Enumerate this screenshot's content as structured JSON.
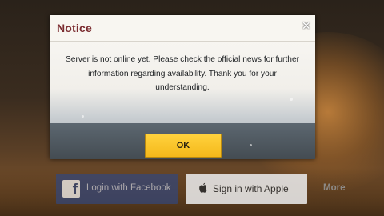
{
  "dialog": {
    "title": "Notice",
    "close_glyph": "×",
    "message": "Server is not online yet. Please check the official news for further information regarding availability. Thank you for your understanding.",
    "ok_label": "OK"
  },
  "login": {
    "facebook_label": "Login with Facebook",
    "facebook_icon": "facebook-icon",
    "apple_label": "Sign in with Apple",
    "apple_icon": "apple-icon",
    "more_label": "More"
  },
  "colors": {
    "title": "#7b2c30",
    "ok_button": "#f4b81a",
    "facebook": "#34477a",
    "apple_button": "#e9e9e9"
  }
}
